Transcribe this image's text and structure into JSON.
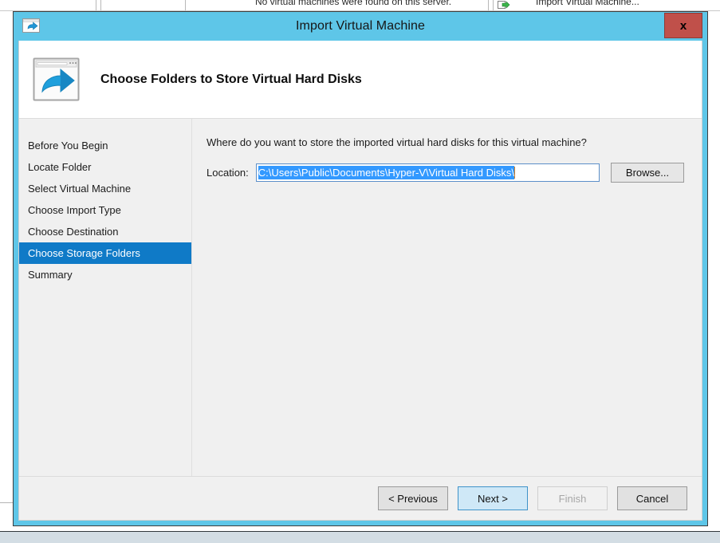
{
  "background": {
    "status_text": "No virtual machines were found on this server.",
    "action_text": "Import Virtual Machine...",
    "action_icon": "import-vm-arrow-icon"
  },
  "dialog": {
    "title": "Import Virtual Machine",
    "title_icon": "import-vm-window-icon",
    "close_label": "x",
    "accent_color": "#5ec6e8",
    "close_color": "#c0504a"
  },
  "header": {
    "icon": "window-with-blue-arrow-icon",
    "title": "Choose Folders to Store Virtual Hard Disks"
  },
  "sidebar": {
    "items": [
      {
        "label": "Before You Begin",
        "selected": false
      },
      {
        "label": "Locate Folder",
        "selected": false
      },
      {
        "label": "Select Virtual Machine",
        "selected": false
      },
      {
        "label": "Choose Import Type",
        "selected": false
      },
      {
        "label": "Choose Destination",
        "selected": false
      },
      {
        "label": "Choose Storage Folders",
        "selected": true
      },
      {
        "label": "Summary",
        "selected": false
      }
    ],
    "selected_color": "#0f7ac7"
  },
  "content": {
    "intro": "Where do you want to store the imported virtual hard disks for this virtual machine?",
    "location_label": "Location:",
    "location_value": "C:\\Users\\Public\\Documents\\Hyper-V\\Virtual Hard Disks\\",
    "location_selected": true,
    "browse_label": "Browse..."
  },
  "footer": {
    "buttons": [
      {
        "label": "< Previous",
        "state": "enabled"
      },
      {
        "label": "Next >",
        "state": "default"
      },
      {
        "label": "Finish",
        "state": "disabled"
      },
      {
        "label": "Cancel",
        "state": "enabled"
      }
    ]
  }
}
